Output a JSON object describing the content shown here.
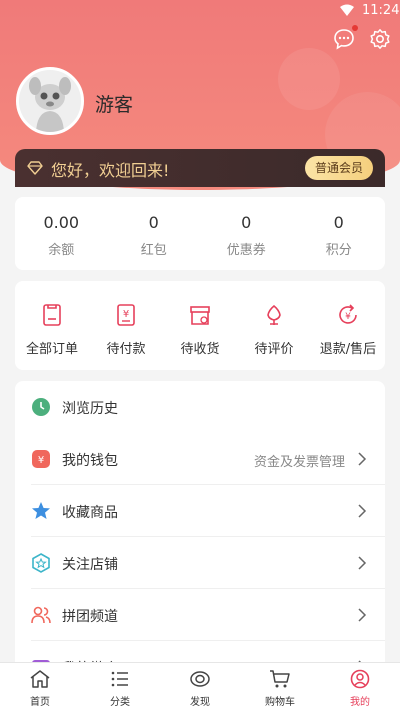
{
  "status_bar": {
    "time": "11:24"
  },
  "profile": {
    "username": "游客"
  },
  "welcome": {
    "text": "您好，欢迎回来!",
    "vip_label": "普通会员"
  },
  "stats": [
    {
      "value": "0.00",
      "label": "余额"
    },
    {
      "value": "0",
      "label": "红包"
    },
    {
      "value": "0",
      "label": "优惠券"
    },
    {
      "value": "0",
      "label": "积分"
    }
  ],
  "orders": [
    {
      "label": "全部订单",
      "icon": "all-orders-icon"
    },
    {
      "label": "待付款",
      "icon": "pending-payment-icon"
    },
    {
      "label": "待收货",
      "icon": "pending-receipt-icon"
    },
    {
      "label": "待评价",
      "icon": "pending-review-icon"
    },
    {
      "label": "退款/售后",
      "icon": "refund-icon"
    }
  ],
  "menu": [
    {
      "label": "浏览历史",
      "extra": "",
      "icon": "history-icon"
    },
    {
      "label": "我的钱包",
      "extra": "资金及发票管理",
      "icon": "wallet-icon"
    },
    {
      "label": "收藏商品",
      "extra": "",
      "icon": "star-icon"
    },
    {
      "label": "关注店铺",
      "extra": "",
      "icon": "shop-icon"
    },
    {
      "label": "拼团频道",
      "extra": "",
      "icon": "group-buy-icon"
    },
    {
      "label": "我的微店",
      "extra": "",
      "icon": "micro-shop-icon"
    }
  ],
  "tabs": [
    {
      "label": "首页",
      "icon": "home-icon"
    },
    {
      "label": "分类",
      "icon": "category-icon"
    },
    {
      "label": "发现",
      "icon": "discover-icon"
    },
    {
      "label": "购物车",
      "icon": "cart-icon"
    },
    {
      "label": "我的",
      "icon": "profile-icon"
    }
  ],
  "colors": {
    "accent": "#e6405b",
    "header": "#f07a79",
    "gold": "#f1cf93",
    "dark_bar": "#3b2a2a"
  }
}
